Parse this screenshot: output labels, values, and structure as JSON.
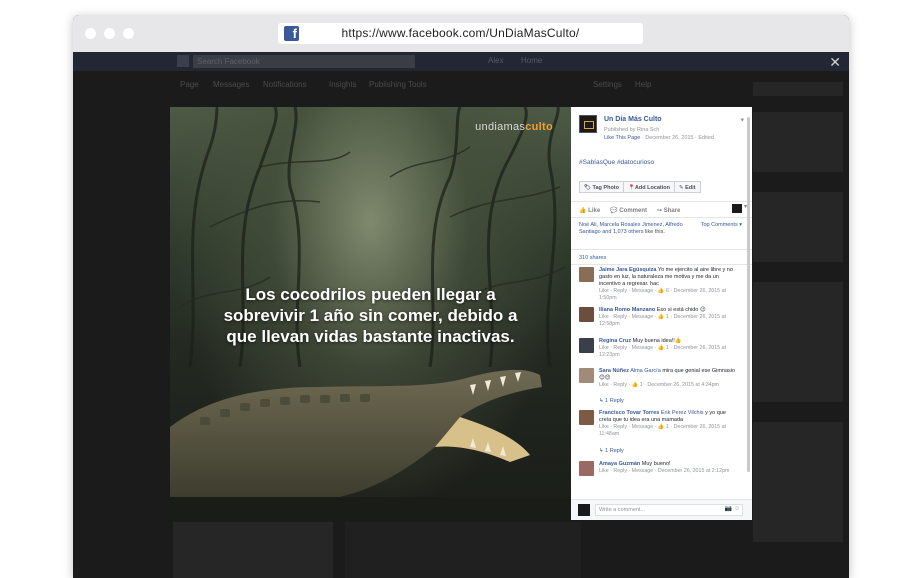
{
  "browser": {
    "url": "https://www.facebook.com/UnDiaMasCulto/"
  },
  "background_page": {
    "search_placeholder": "Search Facebook",
    "top_items": [
      "Alex",
      "Home"
    ],
    "nav_items": [
      "Page",
      "Messages",
      "Notifications",
      "Insights",
      "Publishing Tools",
      "Settings",
      "Help"
    ]
  },
  "photo": {
    "brand_main": "undiamas",
    "brand_accent": "culto",
    "fact_lines": [
      "Los cocodrilos pueden llegar a",
      "sobrevivir 1 año sin comer, debido a",
      "que llevan vidas bastante inactivas."
    ]
  },
  "post": {
    "page_name": "Un Día Más Culto",
    "published_by": "Published by Rina Sch",
    "like_link": "Like This Page",
    "date": "December 26, 2015",
    "edited": "Edited",
    "hashtags": "#SabíasQue #datocurioso",
    "tools": {
      "tag_photo": "Tag Photo",
      "add_location": "Add Location",
      "edit": "Edit"
    },
    "actions": {
      "like": "Like",
      "comment": "Comment",
      "share": "Share"
    },
    "likes_names": "Noé Ali, Marcela Rosales Jimenez, Alfredo Santiago and 1,073 others",
    "likes_suffix": "like this.",
    "top_comments": "Top Comments",
    "shares": "310 shares",
    "comments": [
      {
        "author": "Jaime Jara Egúsquiza",
        "text": "Yo me ejercito al aire libre y no gasto en luz, la naturaleza me motiva y me da un incentivo a regresar. hac",
        "meta": "Like · Reply · Message · 👍 6 · December 26, 2015 at 1:50pm"
      },
      {
        "author": "Iliana Romo Manzano",
        "text": "Eso si está chido 😉",
        "meta": "Like · Reply · Message · 👍 1 · December 26, 2015 at 12:58pm"
      },
      {
        "author": "Regina Cruz",
        "text": "Muy buena idea!!👍",
        "meta": "Like · Reply · Message · 👍 1 · December 26, 2015 at 12:23pm"
      },
      {
        "author": "Sara Núñez",
        "tag": "Alma García",
        "text": "mira que genial ese Gimnasio 😊😊",
        "meta": "Like · Reply · 👍 1 · December 26, 2015 at 4:34pm",
        "reply": "↳ 1 Reply"
      },
      {
        "author": "Francisco Tovar Torres",
        "tag": "Erik Perez Vilchis",
        "text": "y yo que creía que tu idea era una mamada",
        "meta": "Like · Reply · Message · 👍 1 · December 26, 2015 at 11:48am",
        "reply": "↳ 1 Reply"
      },
      {
        "author": "Amaya Guzmán",
        "text": "Muy bueno!",
        "meta": "Like · Reply · Message · December 26, 2015 at 2:12pm"
      }
    ],
    "write_placeholder": "Write a comment...",
    "write_icons": "📷 ☺"
  }
}
